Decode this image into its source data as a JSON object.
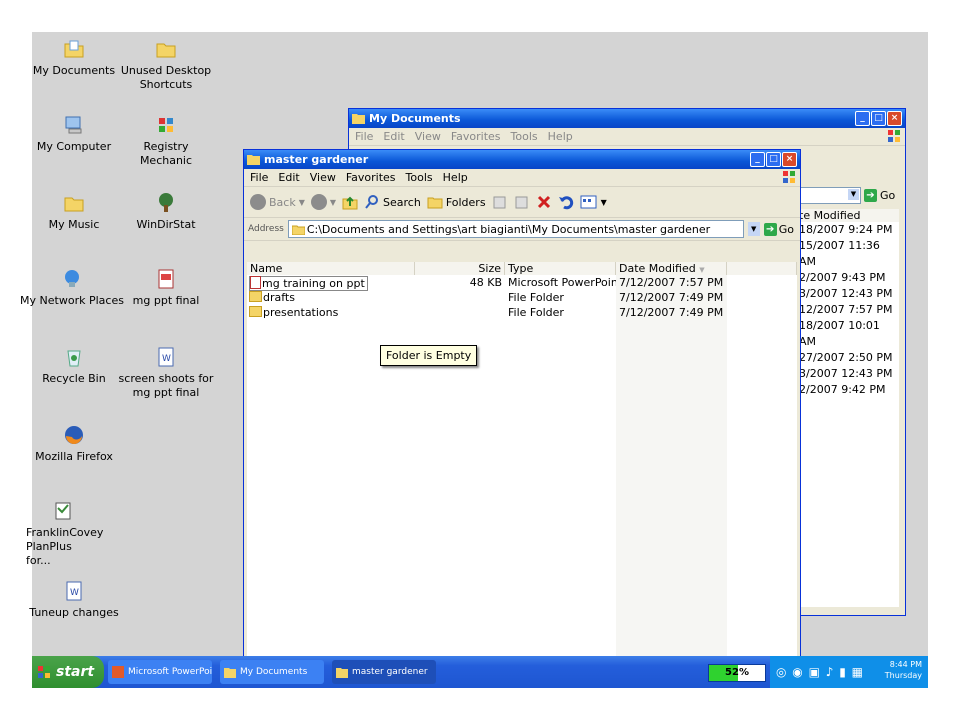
{
  "desktop_icons": [
    {
      "label": "My Documents",
      "icon": "folder-docs-icon"
    },
    {
      "label": "Unused Desktop Shortcuts",
      "icon": "folder-icon"
    },
    {
      "label": "My Computer",
      "icon": "computer-icon"
    },
    {
      "label": "Registry Mechanic",
      "icon": "registry-icon"
    },
    {
      "label": "My Music",
      "icon": "folder-music-icon"
    },
    {
      "label": "WinDirStat",
      "icon": "tree-icon"
    },
    {
      "label": "My Network Places",
      "icon": "network-icon"
    },
    {
      "label": "mg ppt final",
      "icon": "ppt-file-icon"
    },
    {
      "label": "Recycle Bin",
      "icon": "recycle-bin-icon"
    },
    {
      "label": "screen shoots for mg ppt final",
      "icon": "word-file-icon"
    },
    {
      "label": "Mozilla Firefox",
      "icon": "firefox-icon"
    },
    {
      "label": "FranklinCovey PlanPlus for...",
      "icon": "planner-icon"
    },
    {
      "label": "Tuneup changes",
      "icon": "word-file-icon"
    }
  ],
  "back_window": {
    "title": "My Documents",
    "menu": [
      "File",
      "Edit",
      "View",
      "Favorites",
      "Tools",
      "Help"
    ],
    "go_label": "Go",
    "date_header": "te Modified",
    "dates": [
      "18/2007 9:24 PM",
      "15/2007 11:36 AM",
      "2/2007 9:43 PM",
      "3/2007 12:43 PM",
      "12/2007 7:57 PM",
      "18/2007 10:01 AM",
      "27/2007 2:50 PM",
      "3/2007 12:43 PM",
      "2/2007 9:42 PM"
    ]
  },
  "front_window": {
    "title": "master gardener",
    "menu": [
      "File",
      "Edit",
      "View",
      "Favorites",
      "Tools",
      "Help"
    ],
    "toolbar": {
      "back": "Back",
      "search": "Search",
      "folders": "Folders"
    },
    "address_label": "Address",
    "address_value": "C:\\Documents and Settings\\art biagianti\\My Documents\\master gardener",
    "go_label": "Go",
    "columns": [
      "Name",
      "Size",
      "Type",
      "Date Modified"
    ],
    "rows": [
      {
        "name": "mg training on ppt",
        "size": "48 KB",
        "type": "Microsoft PowerPoin...",
        "date": "7/12/2007 7:57 PM"
      },
      {
        "name": "drafts",
        "size": "",
        "type": "File Folder",
        "date": "7/12/2007 7:49 PM"
      },
      {
        "name": "presentations",
        "size": "",
        "type": "File Folder",
        "date": "7/12/2007 7:49 PM"
      }
    ],
    "tooltip": "Folder is Empty"
  },
  "taskbar": {
    "start": "start",
    "tasks": [
      "Microsoft PowerPoin...",
      "My Documents",
      "master gardener"
    ],
    "progress_label": "52%",
    "clock_time": "8:44 PM",
    "clock_day": "Thursday"
  },
  "colors": {
    "desktop": "#d4d4d4",
    "title": "#0a56d6",
    "taskbar": "#245edb",
    "start": "#3c9a3c"
  }
}
